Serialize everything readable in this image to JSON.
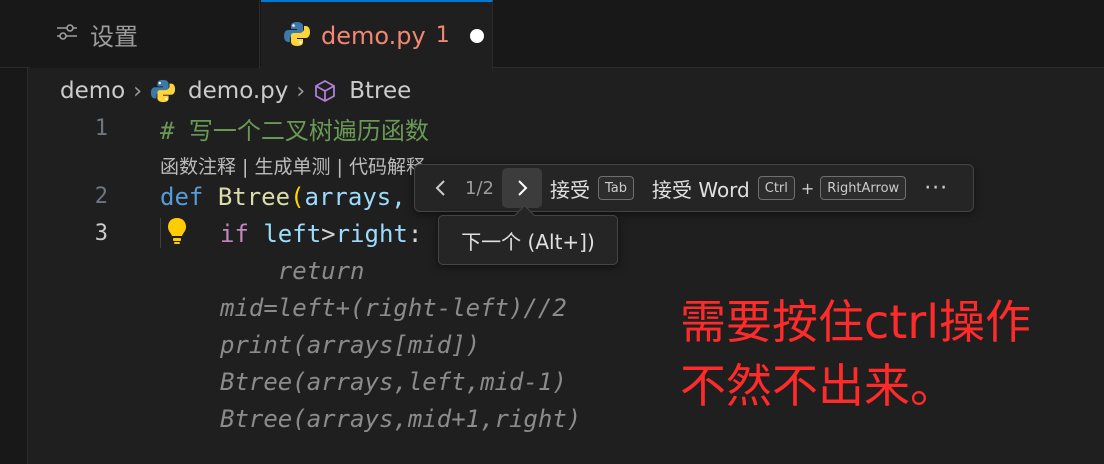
{
  "tabs": {
    "settings_label": "设置",
    "file_label": "demo.py",
    "file_problems": "1"
  },
  "breadcrumb": {
    "folder": "demo",
    "file": "demo.py",
    "symbol": "Btree"
  },
  "editor": {
    "line_numbers": [
      "1",
      "2",
      "3"
    ],
    "line1_comment": "# 写一个二叉树遍历函数",
    "codelens": "函数注释 | 生成单测 | 代码解释",
    "line2": {
      "kw": "def",
      "fn": "Btree",
      "paren": "(",
      "param": "arrays,"
    },
    "line3": {
      "kw": "if",
      "left": "left",
      "op": ">",
      "right": "right",
      "colon": ":"
    },
    "ghost_lines": [
      "    return",
      "mid=left+(right-left)//2",
      "print(arrays[mid])",
      "Btree(arrays,left,mid-1)",
      "Btree(arrays,mid+1,right)"
    ]
  },
  "suggestion_toolbar": {
    "count": "1/2",
    "accept_label": "接受",
    "accept_key": "Tab",
    "accept_word_label": "接受 Word",
    "accept_word_key1": "Ctrl",
    "plus": "+",
    "accept_word_key2": "RightArrow",
    "more": "···"
  },
  "tooltip": {
    "text": "下一个 (Alt+])"
  },
  "annotation": {
    "line1": "需要按住ctrl操作",
    "line2": "不然不出来。"
  },
  "colors": {
    "accent": "#0078d4",
    "error": "#f48771",
    "annotation": "#ff2a2a"
  }
}
